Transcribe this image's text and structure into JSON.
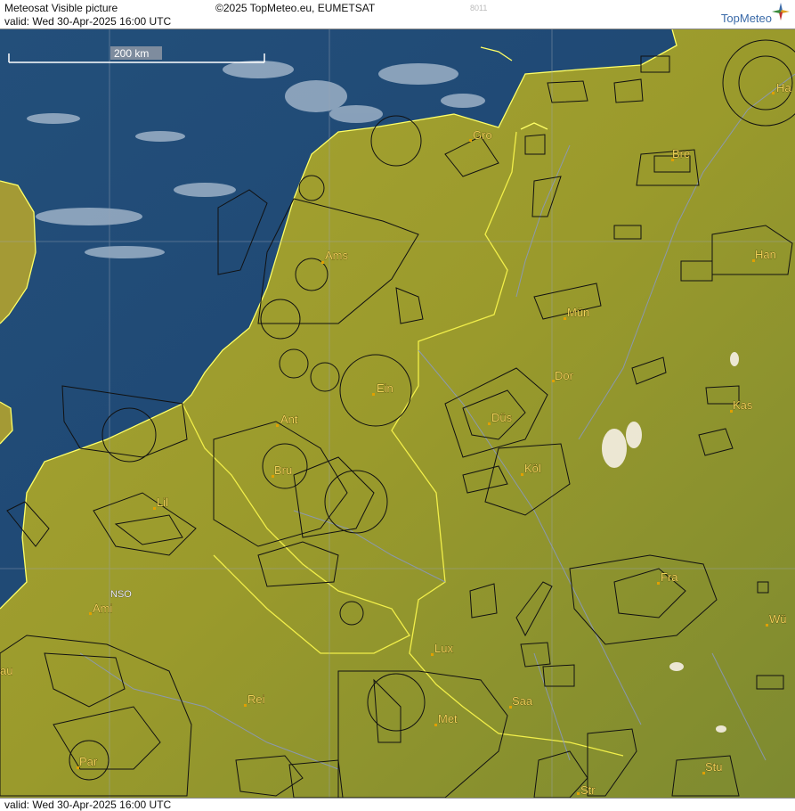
{
  "header": {
    "title": "Meteosat Visible picture",
    "valid": "valid:  Wed  30-Apr-2025  16:00 UTC",
    "copyright": "©2025 TopMeteo.eu, EUMETSAT",
    "code": "8011",
    "brand": "TopMeteo"
  },
  "footer": {
    "valid": "valid:  Wed  30-Apr-2025  16:00 UTC"
  },
  "scale": {
    "label": "200 km"
  },
  "cities": [
    {
      "id": "gro",
      "label": "Gro"
    },
    {
      "id": "bre",
      "label": "Bre"
    },
    {
      "id": "ha",
      "label": "Ha"
    },
    {
      "id": "han",
      "label": "Han"
    },
    {
      "id": "ams",
      "label": "Ams"
    },
    {
      "id": "mun",
      "label": "Mün"
    },
    {
      "id": "dor",
      "label": "Dor"
    },
    {
      "id": "kas",
      "label": "Kas"
    },
    {
      "id": "ein",
      "label": "Ein"
    },
    {
      "id": "ant",
      "label": "Ant"
    },
    {
      "id": "dus",
      "label": "Düs"
    },
    {
      "id": "bru",
      "label": "Bru"
    },
    {
      "id": "kol",
      "label": "Köl"
    },
    {
      "id": "lil",
      "label": "Lil"
    },
    {
      "id": "fra",
      "label": "Fra"
    },
    {
      "id": "nso",
      "label": "NSO"
    },
    {
      "id": "ami",
      "label": "Ami"
    },
    {
      "id": "wu",
      "label": "Wü"
    },
    {
      "id": "lux",
      "label": "Lux"
    },
    {
      "id": "au",
      "label": "au"
    },
    {
      "id": "rei",
      "label": "Rei"
    },
    {
      "id": "saa",
      "label": "Saa"
    },
    {
      "id": "met",
      "label": "Met"
    },
    {
      "id": "par",
      "label": "Par"
    },
    {
      "id": "stu",
      "label": "Stu"
    },
    {
      "id": "str",
      "label": "Str"
    }
  ],
  "colors": {
    "sea": "#1f4e79",
    "land": "#9c9a2e",
    "coastline": "#ffff66",
    "airspace": "#111111",
    "labels": "#f0d25a",
    "rivers": "#7f93c8"
  }
}
